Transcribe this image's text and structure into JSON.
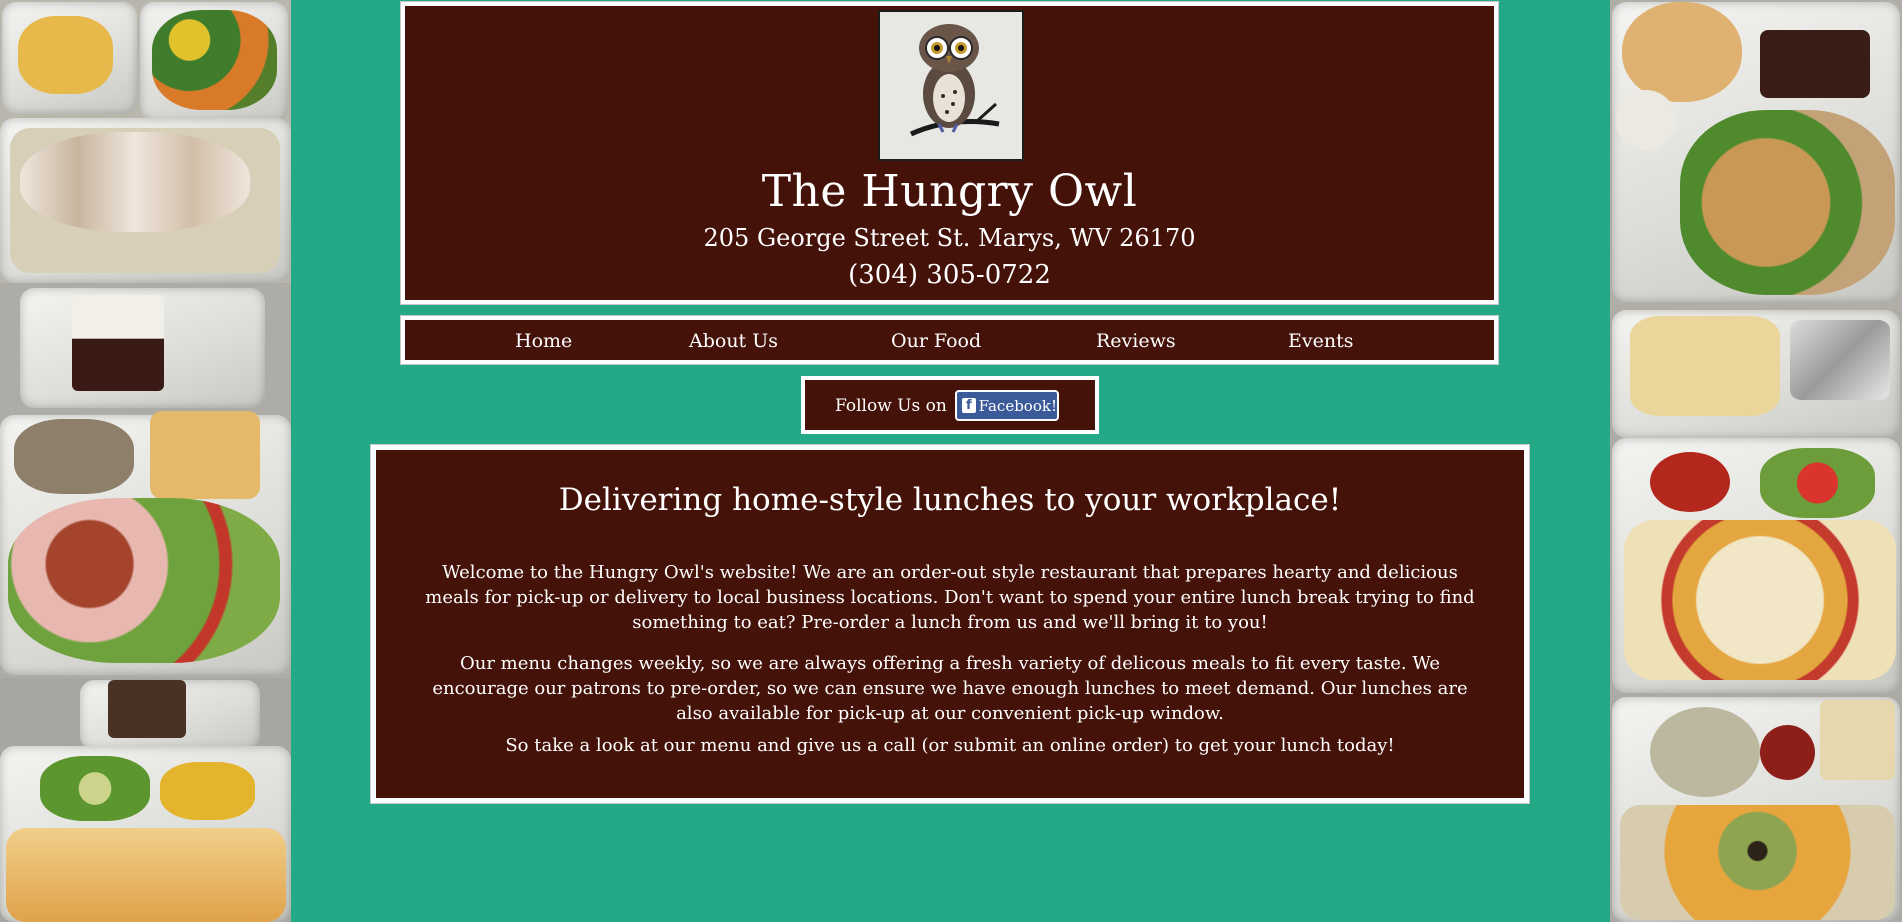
{
  "header": {
    "logo_icon": "owl-drawing-icon",
    "title": "The Hungry Owl",
    "address": "205 George Street St. Marys, WV 26170",
    "phone": "(304) 305-0722"
  },
  "nav": {
    "items": [
      {
        "label": "Home"
      },
      {
        "label": "About Us"
      },
      {
        "label": "Our Food"
      },
      {
        "label": "Reviews"
      },
      {
        "label": "Events"
      }
    ]
  },
  "social": {
    "follow_label": "Follow Us on",
    "facebook_label": "Facebook!",
    "facebook_icon": "facebook-icon"
  },
  "main": {
    "heading": "Delivering home-style lunches to your workplace!",
    "paragraphs": [
      "Welcome to the Hungry Owl's website! We are an order-out style restaurant that prepares hearty and delicious meals for pick-up or delivery to local business locations. Don't want to spend your entire lunch break trying to find something to eat? Pre-order a lunch from us and we'll bring it to you!",
      "Our menu changes weekly, so we are always offering a fresh variety of delicous meals to fit every taste. We encourage our patrons to pre-order, so we can ensure we have enough lunches to meet demand. Our lunches are also available for pick-up at our convenient pick-up window.",
      "So take a look at our menu and give us a call (or submit an online order) to get your lunch today!"
    ]
  },
  "colors": {
    "background": "#23a888",
    "panel": "#441209",
    "border": "#ffffff",
    "facebook": "#3b5a9a"
  }
}
